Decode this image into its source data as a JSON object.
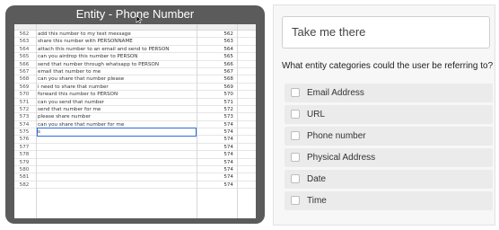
{
  "window": {
    "title": "Entity - Phone Number"
  },
  "sheet": {
    "rows": [
      {
        "num": "562",
        "text": "add this number to my text message",
        "id": "562"
      },
      {
        "num": "563",
        "text": "share this number with PERSONNAME",
        "id": "563"
      },
      {
        "num": "564",
        "text": "attach this number to an email and send to PERSON",
        "id": "564"
      },
      {
        "num": "565",
        "text": "can you airdrop this number to PERSON",
        "id": "565"
      },
      {
        "num": "566",
        "text": "send that number through whatsapp to PERSON",
        "id": "566"
      },
      {
        "num": "567",
        "text": "email that number to me",
        "id": "567"
      },
      {
        "num": "568",
        "text": "can you share that number please",
        "id": "568"
      },
      {
        "num": "569",
        "text": "i need to share that number",
        "id": "569"
      },
      {
        "num": "570",
        "text": "forward this number to PERSON",
        "id": "570"
      },
      {
        "num": "571",
        "text": "can you send that number",
        "id": "571"
      },
      {
        "num": "572",
        "text": "send that number for me",
        "id": "572"
      },
      {
        "num": "573",
        "text": "please share number",
        "id": "573"
      },
      {
        "num": "574",
        "text": "can you share that number for me",
        "id": "574"
      },
      {
        "num": "575",
        "text": "s",
        "id": "574"
      },
      {
        "num": "576",
        "text": "",
        "id": "574"
      },
      {
        "num": "577",
        "text": "",
        "id": "574"
      },
      {
        "num": "578",
        "text": "",
        "id": "574"
      },
      {
        "num": "579",
        "text": "",
        "id": "574"
      },
      {
        "num": "580",
        "text": "",
        "id": "574"
      },
      {
        "num": "581",
        "text": "",
        "id": "574"
      },
      {
        "num": "582",
        "text": "",
        "id": "574"
      }
    ]
  },
  "panel": {
    "button_label": "Take me there",
    "question": "What entity categories could the user be referring to?",
    "options": [
      {
        "label": "Email Address"
      },
      {
        "label": "URL"
      },
      {
        "label": "Phone number"
      },
      {
        "label": "Physical Address"
      },
      {
        "label": "Date"
      },
      {
        "label": "Time"
      }
    ]
  },
  "colors": {
    "window_bg": "#5b5b5b",
    "active_cell_border": "#2b6cd8",
    "option_bg": "#ebebeb"
  }
}
